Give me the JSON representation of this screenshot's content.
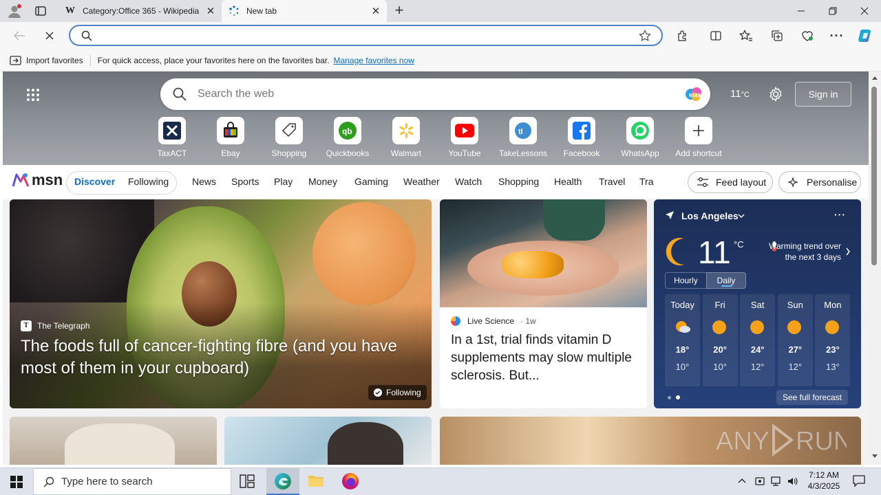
{
  "browser": {
    "tabs": [
      {
        "title": "Category:Office 365 - Wikipedia",
        "favicon": "W"
      },
      {
        "title": "New tab"
      }
    ],
    "favorites_bar": {
      "import_label": "Import favorites",
      "message": "For quick access, place your favorites here on the favorites bar.",
      "manage_link": "Manage favorites now"
    }
  },
  "newtab": {
    "search_placeholder": "Search the web",
    "weather_temp": "11",
    "weather_unit": "°C",
    "sign_in": "Sign in",
    "shortcuts": [
      {
        "label": "TaxACT",
        "icon": "taxact-icon",
        "color": "#1a2a4a"
      },
      {
        "label": "Ebay",
        "icon": "ebay-icon",
        "color": "#e53238"
      },
      {
        "label": "Shopping",
        "icon": "shopping-tag-icon",
        "color": "#333333"
      },
      {
        "label": "Quickbooks",
        "icon": "quickbooks-icon",
        "color": "#2ca01c"
      },
      {
        "label": "Walmart",
        "icon": "walmart-icon",
        "color": "#0071ce"
      },
      {
        "label": "YouTube",
        "icon": "youtube-icon",
        "color": "#ff0000"
      },
      {
        "label": "TakeLessons",
        "icon": "takelessons-icon",
        "color": "#3d8fd1"
      },
      {
        "label": "Facebook",
        "icon": "facebook-icon",
        "color": "#1877f2"
      },
      {
        "label": "WhatsApp",
        "icon": "whatsapp-icon",
        "color": "#25d366"
      },
      {
        "label": "Add shortcut",
        "icon": "plus-icon",
        "color": "#333333"
      }
    ]
  },
  "msn": {
    "logo": "msn",
    "pills": [
      "Discover",
      "Following"
    ],
    "nav": [
      "News",
      "Sports",
      "Play",
      "Money",
      "Gaming",
      "Weather",
      "Watch",
      "Shopping",
      "Health",
      "Travel",
      "Tra"
    ],
    "feed_layout": "Feed layout",
    "personalise": "Personalise"
  },
  "cards": {
    "main": {
      "source": "The Telegraph",
      "headline": "The foods full of cancer-fighting fibre (and you have most of them in your cupboard)",
      "badge": "Following"
    },
    "second": {
      "source": "Live Science",
      "age": "1w",
      "headline": "In a 1st, trial finds vitamin D supplements may slow multiple sclerosis. But..."
    }
  },
  "weather": {
    "location": "Los Angeles",
    "temp": "11",
    "unit": "°C",
    "trend": "Warming trend over the next 3 days",
    "tabs": [
      "Hourly",
      "Daily"
    ],
    "days": [
      {
        "day": "Today",
        "high": "18°",
        "low": "10°"
      },
      {
        "day": "Fri",
        "high": "20°",
        "low": "10°"
      },
      {
        "day": "Sat",
        "high": "24°",
        "low": "12°"
      },
      {
        "day": "Sun",
        "high": "27°",
        "low": "12°"
      },
      {
        "day": "Mon",
        "high": "23°",
        "low": "13°"
      }
    ],
    "forecast_link": "See full forecast"
  },
  "taskbar": {
    "search_placeholder": "Type here to search",
    "time": "7:12 AM",
    "date": "4/3/2025"
  }
}
